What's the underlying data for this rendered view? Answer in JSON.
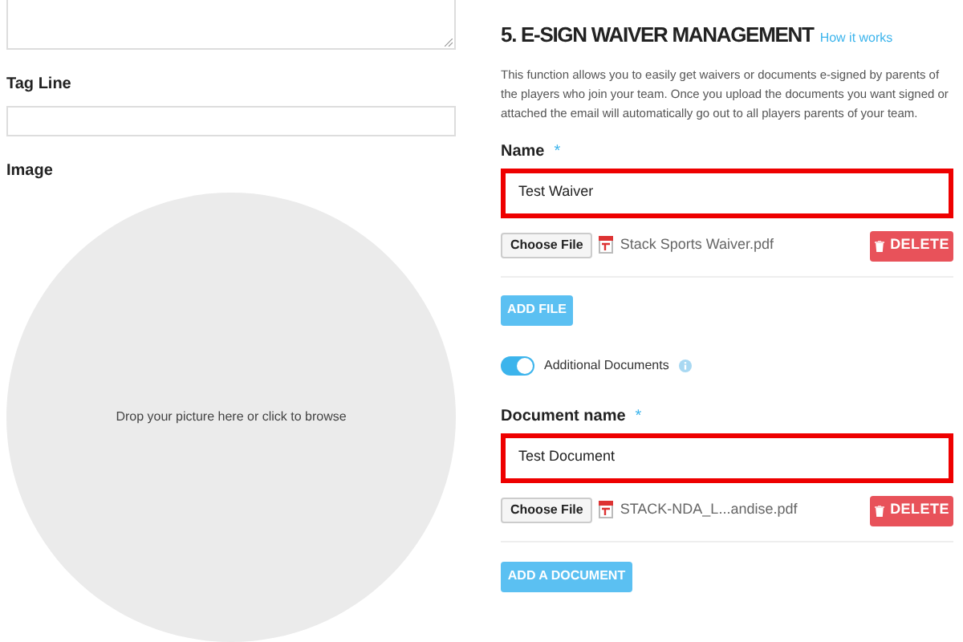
{
  "left": {
    "tagline": {
      "label": "Tag Line"
    },
    "image": {
      "label": "Image",
      "dropzone": "Drop your picture here or click to browse"
    }
  },
  "section": {
    "title": "5. E-SIGN WAIVER MANAGEMENT",
    "help_link": "How it works",
    "description": "This function allows you to easily get waivers or documents e-signed by parents of the players who join your team. Once you upload the documents you want signed or attached the email will automatically go out to all players parents of your team.",
    "name": {
      "label": "Name",
      "required": "*",
      "value": "Test Waiver",
      "highlighted": true
    },
    "file": {
      "choose": "Choose File",
      "filename": "Stack Sports Waiver.pdf",
      "delete": "DELETE"
    },
    "add_file": "ADD FILE",
    "additional": {
      "label": "Additional Documents",
      "on": true
    },
    "document": {
      "label": "Document name",
      "required": "*",
      "value": "Test Document",
      "highlighted": true
    },
    "document_file": {
      "choose": "Choose File",
      "filename": "STACK-NDA_L...andise.pdf",
      "delete": "DELETE"
    },
    "add_document": "ADD A DOCUMENT"
  }
}
